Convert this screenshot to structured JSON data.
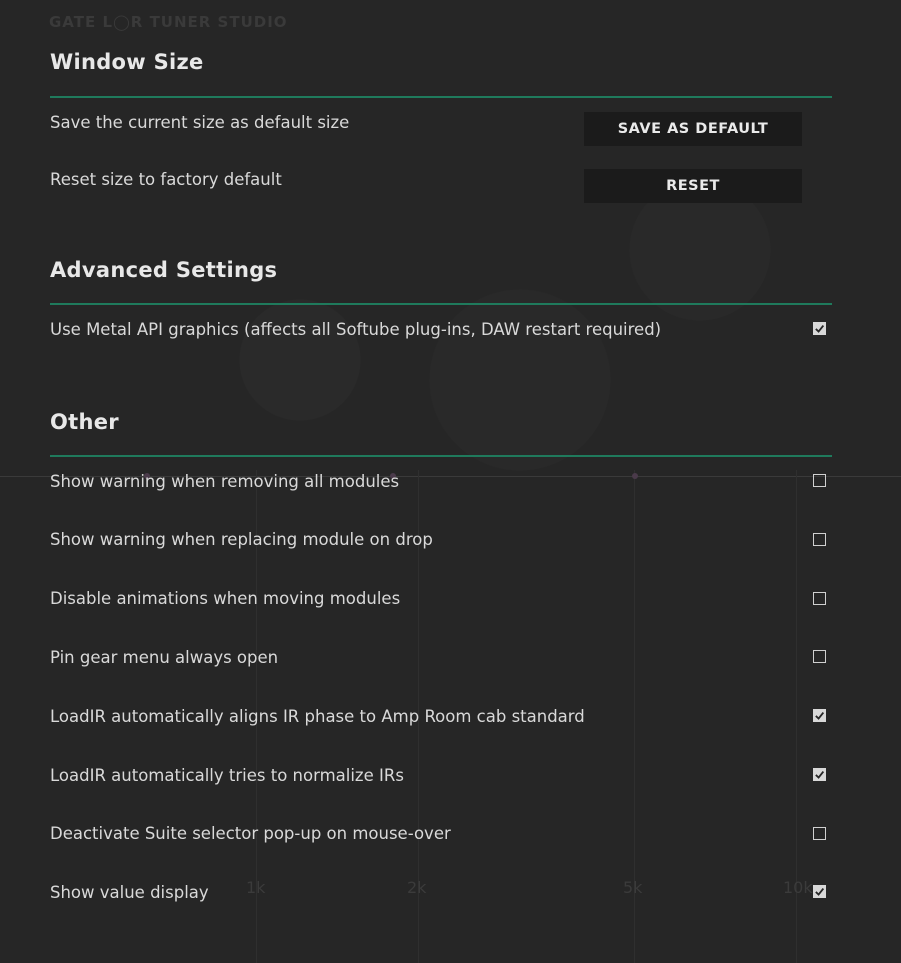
{
  "background": {
    "top_text": "GATE   L◯R   TUNER STUDIO",
    "axis_ticks": [
      "1k",
      "2k",
      "5k",
      "10k"
    ]
  },
  "colors": {
    "accent": "#1f7a5c",
    "background": "#262626",
    "button_bg": "#1b1b1b"
  },
  "window_size": {
    "title": "Window Size",
    "save_label": "Save the current size as default size",
    "save_button": "SAVE AS DEFAULT",
    "reset_label": "Reset size to factory default",
    "reset_button": "RESET"
  },
  "advanced": {
    "title": "Advanced Settings",
    "items": [
      {
        "label": "Use Metal API graphics (affects all Softube plug-ins, DAW restart required)",
        "checked": true
      }
    ]
  },
  "other": {
    "title": "Other",
    "items": [
      {
        "label": "Show warning when removing all modules",
        "checked": false
      },
      {
        "label": "Show warning when replacing module on drop",
        "checked": false
      },
      {
        "label": "Disable animations when moving modules",
        "checked": false
      },
      {
        "label": "Pin gear menu always open",
        "checked": false
      },
      {
        "label": "LoadIR automatically aligns IR phase to Amp Room cab standard",
        "checked": true
      },
      {
        "label": "LoadIR automatically tries to normalize IRs",
        "checked": true
      },
      {
        "label": "Deactivate Suite selector pop-up on mouse-over",
        "checked": false
      },
      {
        "label": "Show value display",
        "checked": true
      }
    ]
  }
}
